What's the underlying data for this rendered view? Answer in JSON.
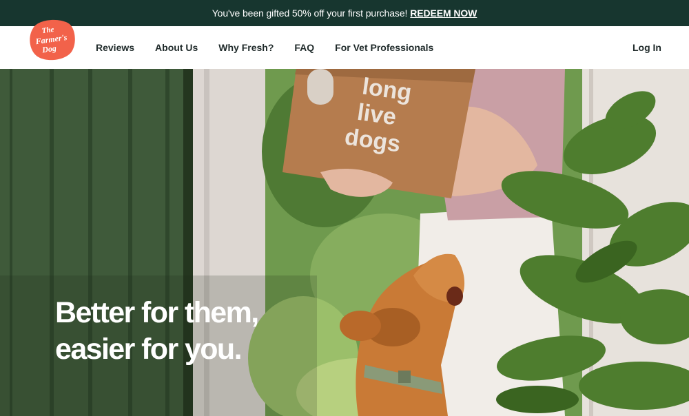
{
  "promo": {
    "message": "You've been gifted 50% off your first purchase!",
    "cta": "REDEEM NOW"
  },
  "brand": {
    "logo_line1": "The",
    "logo_line2": "Farmer's",
    "logo_line3": "Dog",
    "logo_color": "#f2624a"
  },
  "nav": {
    "items": [
      "Reviews",
      "About Us",
      "Why Fresh?",
      "FAQ",
      "For Vet Professionals"
    ],
    "login": "Log In"
  },
  "hero": {
    "box_text_1": "long",
    "box_text_2": "live",
    "box_text_3": "dogs",
    "headline_line1": "Better for them,",
    "headline_line2": "easier for you."
  },
  "colors": {
    "banner_bg": "#17362f",
    "door_green": "#3f5a3a",
    "box_brown": "#b57c4e",
    "dog_orange": "#c97a36"
  }
}
